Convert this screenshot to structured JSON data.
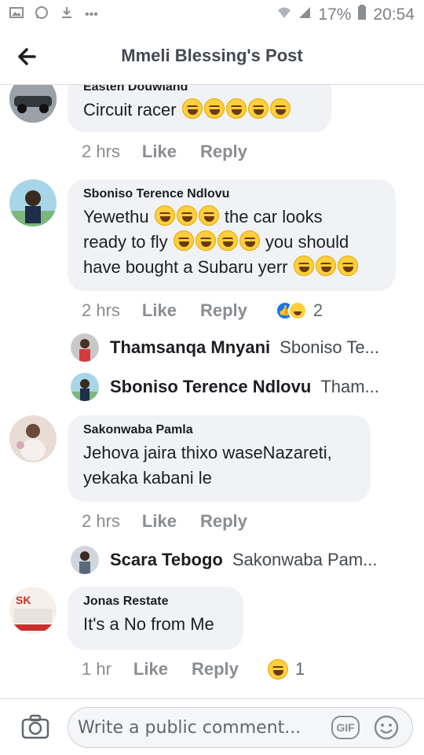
{
  "status_bar": {
    "battery": "17%",
    "time": "20:54",
    "left_icons": [
      "image-icon",
      "whatsapp-icon",
      "download-icon",
      "more-dots-icon"
    ],
    "right_icons": [
      "wifi-icon",
      "signal-icon",
      "battery-icon"
    ]
  },
  "header": {
    "title": "Mmeli Blessing's Post"
  },
  "comments": [
    {
      "author": "Easten Douwland",
      "text": "Circuit racer",
      "emoji_count": 5,
      "time": "2 hrs",
      "like": "Like",
      "reply": "Reply"
    },
    {
      "author": "Sboniso Terence Ndlovu",
      "text_line1": "Yewethu",
      "text_line1b": "the car looks",
      "text_line2a": "ready to fly",
      "text_line2b": "you should",
      "text_line3": "have bought a Subaru yerr",
      "time": "2 hrs",
      "like": "Like",
      "reply": "Reply",
      "reaction_count": "2",
      "replies": [
        {
          "name": "Thamsanqa Mnyani",
          "preview": "Sboniso Te..."
        },
        {
          "name": "Sboniso Terence Ndlovu",
          "preview": "Tham..."
        }
      ]
    },
    {
      "author": "Sakonwaba Pamla",
      "text_line1": "Jehova jaira thixo waseNazareti,",
      "text_line2": "yekaka kabani le",
      "time": "2 hrs",
      "like": "Like",
      "reply": "Reply",
      "replies": [
        {
          "name": "Scara Tebogo",
          "preview": "Sakonwaba Pam..."
        }
      ]
    },
    {
      "author": "Jonas Restate",
      "text": "It's a No from Me",
      "time": "1 hr",
      "like": "Like",
      "reply": "Reply",
      "reaction_count": "1",
      "avatar_text": "SK"
    }
  ],
  "composer": {
    "placeholder": "Write a public comment...",
    "gif_label": "GIF"
  },
  "colors": {
    "bubble": "#f0f2f5",
    "meta_text": "#8a8d91",
    "like_blue": "#1877f2",
    "emoji_yellow": "#ffcf3d"
  }
}
